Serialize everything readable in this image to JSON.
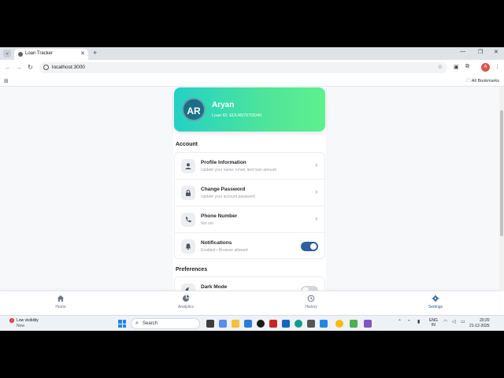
{
  "browser": {
    "tab_title": "Loan Tracker",
    "tab_list_glyph": "⌄",
    "close_glyph": "✕",
    "new_tab_glyph": "+",
    "min_glyph": "—",
    "max_glyph": "❐",
    "win_close_glyph": "✕",
    "back_glyph": "←",
    "forward_glyph": "→",
    "reload_glyph": "↻",
    "url": "localhost:3000",
    "star_glyph": "☆",
    "ext_glyph": "▣",
    "ext2_glyph": "⧉",
    "profile_initial": "A",
    "menu_glyph": "⋮",
    "apps_glyph": "⊞",
    "all_bookmarks": "All Bookmarks",
    "folder_glyph": "🗀"
  },
  "profile": {
    "initials": "AR",
    "name": "Aryan",
    "loan_id": "Loan ID: EDU45757DD40"
  },
  "sections": {
    "account": "Account",
    "preferences": "Preferences"
  },
  "account_items": [
    {
      "title": "Profile Information",
      "subtitle": "Update your name, email, and loan amount",
      "icon": "person-icon"
    },
    {
      "title": "Change Password",
      "subtitle": "Update your account password",
      "icon": "lock-icon"
    },
    {
      "title": "Phone Number",
      "subtitle": "Not set",
      "icon": "phone-icon"
    },
    {
      "title": "Notifications",
      "subtitle": "Enabled • Browser allowed",
      "icon": "bell-icon",
      "toggle": true
    }
  ],
  "preference_items": [
    {
      "title": "Dark Mode",
      "icon": "moon-icon",
      "toggle": false
    }
  ],
  "chevron": "›",
  "bottom_nav": [
    {
      "label": "Home",
      "icon": "home-icon"
    },
    {
      "label": "Analytics",
      "icon": "chart-icon"
    },
    {
      "label": "History",
      "icon": "history-icon"
    },
    {
      "label": "Settings",
      "icon": "gear-icon",
      "active": true
    }
  ],
  "taskbar": {
    "weather_badge": "1",
    "weather_title": "Low visibility",
    "weather_sub": "Now",
    "search_placeholder": "Search",
    "search_glyph": "⌕",
    "tray_up": "⌃",
    "lang_line1": "ENG",
    "lang_line2": "IN",
    "time": "20:20",
    "date": "21-12-2025"
  },
  "colors": {
    "accent": "#2f5e9e",
    "hero_start": "#22d1c6",
    "hero_end": "#5ff08e",
    "avatar": "#1a6f84"
  }
}
